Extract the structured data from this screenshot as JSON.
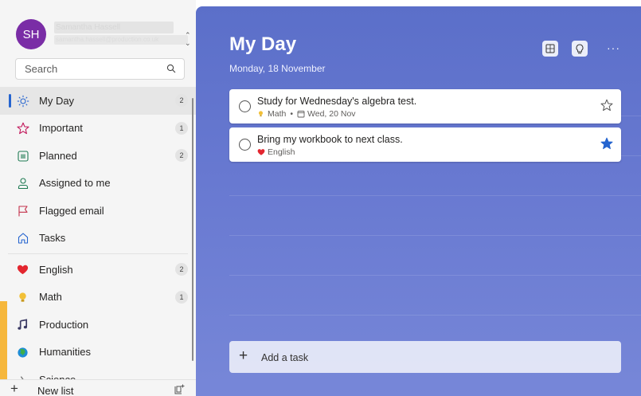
{
  "account": {
    "initials": "SH",
    "name": "Samantha Hassell",
    "email": "samantha.hassell@production.co.uk"
  },
  "search": {
    "placeholder": "Search"
  },
  "sidebar": {
    "items": [
      {
        "label": "My Day",
        "count": "2",
        "icon": "sun-icon"
      },
      {
        "label": "Important",
        "count": "1",
        "icon": "star-outline-icon"
      },
      {
        "label": "Planned",
        "count": "2",
        "icon": "calendar-grid-icon"
      },
      {
        "label": "Assigned to me",
        "count": "",
        "icon": "person-icon"
      },
      {
        "label": "Flagged email",
        "count": "",
        "icon": "flag-icon"
      },
      {
        "label": "Tasks",
        "count": "",
        "icon": "home-icon"
      }
    ],
    "lists": [
      {
        "label": "English",
        "count": "2",
        "icon": "heart-icon"
      },
      {
        "label": "Math",
        "count": "1",
        "icon": "lightbulb-icon"
      },
      {
        "label": "Production",
        "count": "",
        "icon": "music-note-icon"
      },
      {
        "label": "Humanities",
        "count": "",
        "icon": "globe-icon"
      },
      {
        "label": "Science",
        "count": "",
        "icon": "microscope-icon"
      }
    ],
    "new_list_label": "New list"
  },
  "main": {
    "title": "My Day",
    "date": "Monday, 18 November",
    "tasks": [
      {
        "title": "Study for Wednesday's algebra test.",
        "list": "Math",
        "due": "Wed, 20 Nov",
        "important": false
      },
      {
        "title": "Bring my workbook to next class.",
        "list": "English",
        "due": "",
        "important": true
      }
    ],
    "add_task_label": "Add a task"
  },
  "colors": {
    "accent": "#2564cf",
    "avatar": "#7a2da6",
    "main_bg": "#6474cf",
    "heart": "#e3262f",
    "bulb": "#f2c037"
  }
}
